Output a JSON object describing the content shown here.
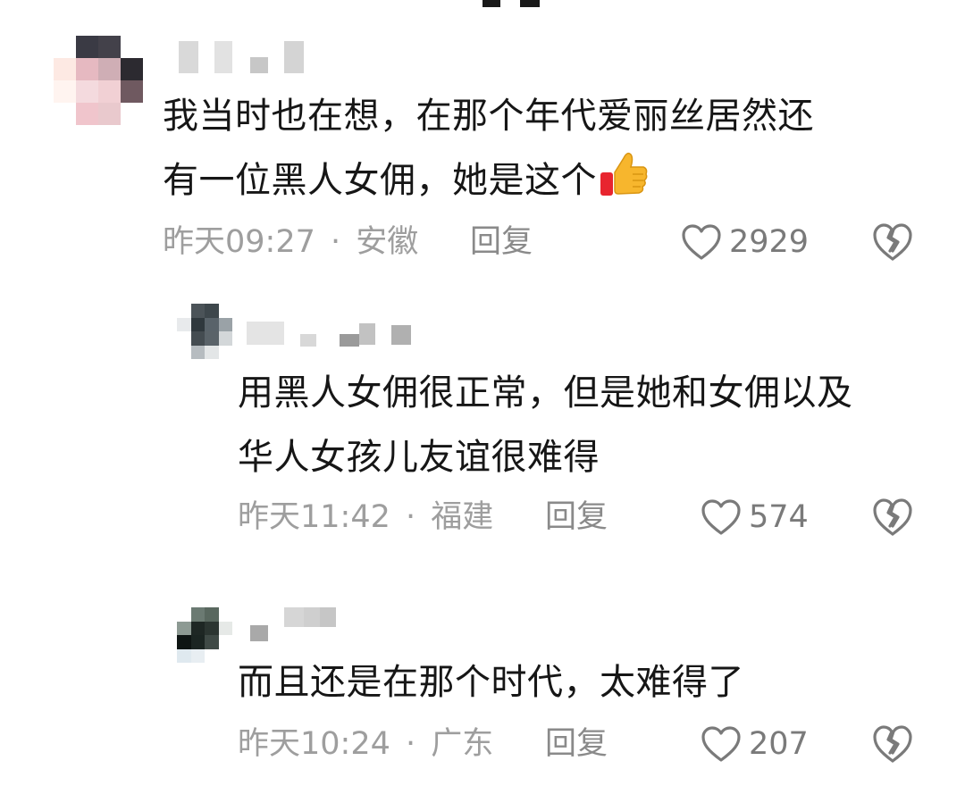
{
  "comments": [
    {
      "text_lines": [
        "我当时也在想，在那个年代爱丽丝居然还",
        "有一位黑人女佣，她是这个"
      ],
      "emoji": "thumbs-up-icon",
      "time": "昨天09:27",
      "separator": "·",
      "location": "安徽",
      "reply_label": "回复",
      "likes": "2929"
    },
    {
      "text_lines": [
        "用黑人女佣很正常，但是她和女佣以及",
        "华人女孩儿友谊很难得"
      ],
      "time": "昨天11:42",
      "separator": "·",
      "location": "福建",
      "reply_label": "回复",
      "likes": "574"
    },
    {
      "text_lines": [
        "而且还是在那个时代，太难得了"
      ],
      "time": "昨天10:24",
      "separator": "·",
      "location": "广东",
      "reply_label": "回复",
      "likes": "207"
    }
  ],
  "icons": {
    "like": "heart-outline-icon",
    "dislike": "broken-heart-icon"
  },
  "colors": {
    "text": "#161616",
    "meta": "#9e9e9e",
    "icon": "#7a7a7a"
  }
}
